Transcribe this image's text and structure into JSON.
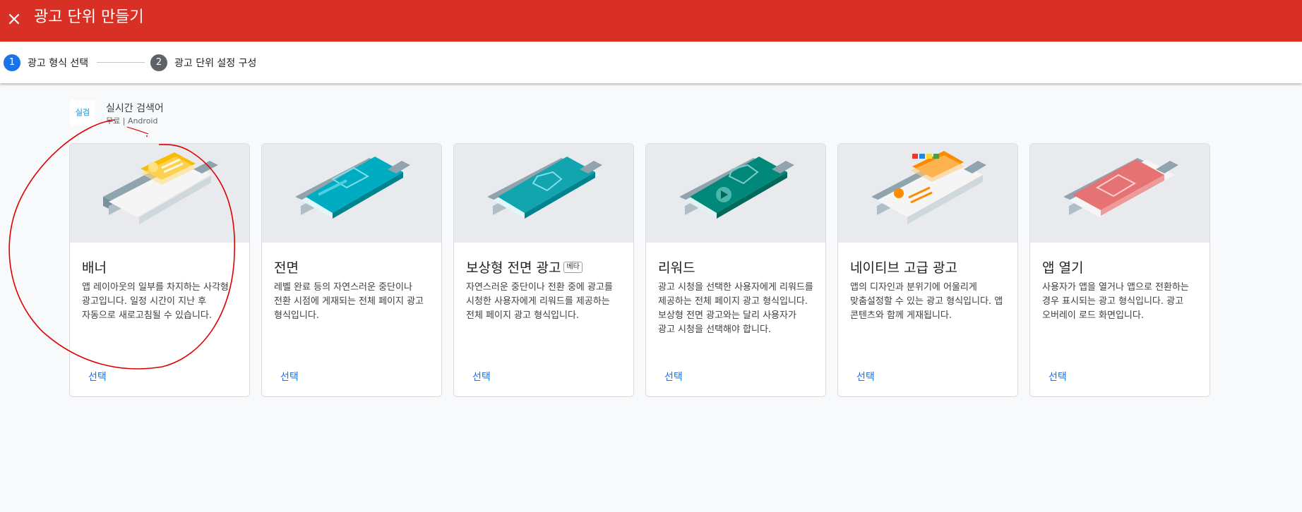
{
  "header": {
    "title": "광고 단위 만들기",
    "close_icon": "close-icon",
    "color": "#d93025"
  },
  "stepper": {
    "steps": [
      {
        "number": "1",
        "label": "광고 형식 선택",
        "color": "#1a73e8"
      },
      {
        "number": "2",
        "label": "광고 단위 설정 구성",
        "color": "#5f6368"
      }
    ]
  },
  "app": {
    "icon_text": "실검",
    "name": "실시간 검색어",
    "meta": "무료 | Android"
  },
  "formats": [
    {
      "title": "배너",
      "badge": "",
      "description": "앱 레이아웃의 일부를 차지하는 사각형 광고입니다. 일정 시간이 지난 후 자동으로 새로고침될 수 있습니다.",
      "select_label": "선택"
    },
    {
      "title": "전면",
      "badge": "",
      "description": "레벨 완료 등의 자연스러운 중단이나 전환 시점에 게재되는 전체 페이지 광고 형식입니다.",
      "select_label": "선택"
    },
    {
      "title": "보상형 전면 광고",
      "badge": "베타",
      "description": "자연스러운 중단이나 전환 중에 광고를 시청한 사용자에게 리워드를 제공하는 전체 페이지 광고 형식입니다.",
      "select_label": "선택"
    },
    {
      "title": "리워드",
      "badge": "",
      "description": "광고 시청을 선택한 사용자에게 리워드를 제공하는 전체 페이지 광고 형식입니다. 보상형 전면 광고와는 달리 사용자가 광고 시청을 선택해야 합니다.",
      "select_label": "선택"
    },
    {
      "title": "네이티브 고급 광고",
      "badge": "",
      "description": "앱의 디자인과 분위기에 어울리게 맞춤설정할 수 있는 광고 형식입니다. 앱 콘텐츠와 함께 게재됩니다.",
      "select_label": "선택"
    },
    {
      "title": "앱 열기",
      "badge": "",
      "description": "사용자가 앱을 열거나 앱으로 전환하는 경우 표시되는 광고 형식입니다. 광고 오버레이 로드 화면입니다.",
      "select_label": "선택"
    }
  ],
  "colors": {
    "accent": "#1a73e8",
    "banner": "#fbbc04",
    "interstitial": "#00acc1",
    "rewarded_interstitial": "#12a4af",
    "rewarded": "#00897b",
    "native": "#fb8c00",
    "app_open": "#e57373",
    "annotation": "#e00000"
  }
}
